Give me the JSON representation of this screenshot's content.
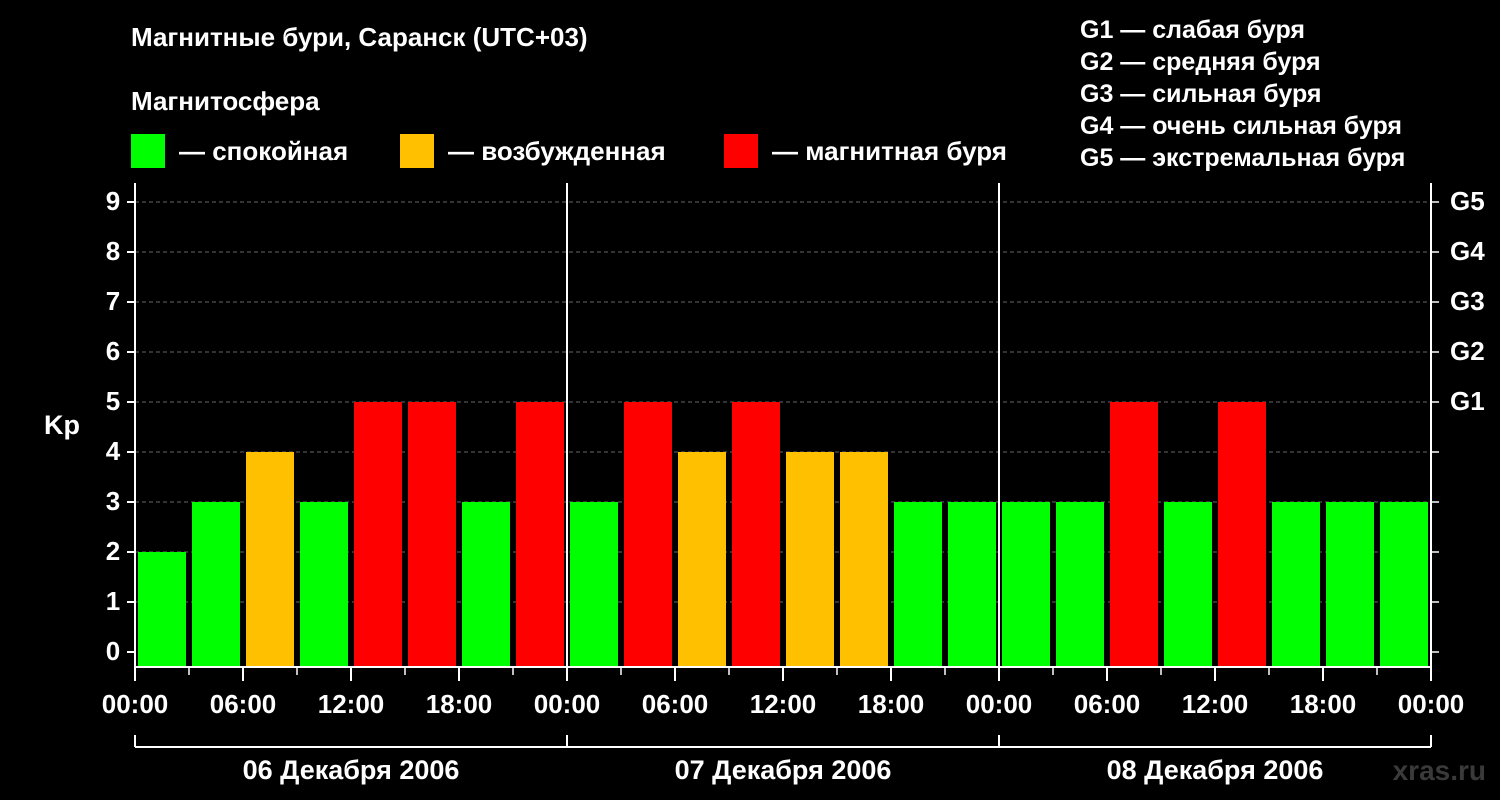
{
  "title": "Магнитные бури, Саранск (UTC+03)",
  "magnetosphere_heading": "Магнитосфера",
  "legend": [
    {
      "label": "— спокойная",
      "color": "#00ff00"
    },
    {
      "label": "— возбужденная",
      "color": "#ffc000"
    },
    {
      "label": "— магнитная буря",
      "color": "#ff0000"
    }
  ],
  "storm_scale": [
    "G1 — слабая буря",
    "G2 — средняя буря",
    "G3 — сильная буря",
    "G4 — очень сильная буря",
    "G5 — экстремальная буря"
  ],
  "watermark": "xras.ru",
  "chart_data": {
    "type": "bar",
    "ylabel": "Kp",
    "ylim": [
      0,
      9
    ],
    "yticks": [
      "0",
      "1",
      "2",
      "3",
      "4",
      "5",
      "6",
      "7",
      "8",
      "9"
    ],
    "right_labels": [
      {
        "kp": 5,
        "label": "G1"
      },
      {
        "kp": 6,
        "label": "G2"
      },
      {
        "kp": 7,
        "label": "G3"
      },
      {
        "kp": 8,
        "label": "G4"
      },
      {
        "kp": 9,
        "label": "G5"
      }
    ],
    "xticks": [
      "00:00",
      "06:00",
      "12:00",
      "18:00",
      "00:00",
      "06:00",
      "12:00",
      "18:00",
      "00:00",
      "06:00",
      "12:00",
      "18:00",
      "00:00"
    ],
    "days": [
      "06 Декабря 2006",
      "07 Декабря 2006",
      "08 Декабря 2006"
    ],
    "interval_hours": 3,
    "grid": true,
    "values": [
      2,
      3,
      4,
      3,
      5,
      5,
      3,
      5,
      3,
      5,
      4,
      5,
      4,
      4,
      3,
      3,
      3,
      3,
      5,
      3,
      5,
      3,
      3,
      3
    ],
    "colors": {
      "quiet": "#00ff00",
      "unsettled": "#ffc000",
      "storm": "#ff0000"
    }
  }
}
